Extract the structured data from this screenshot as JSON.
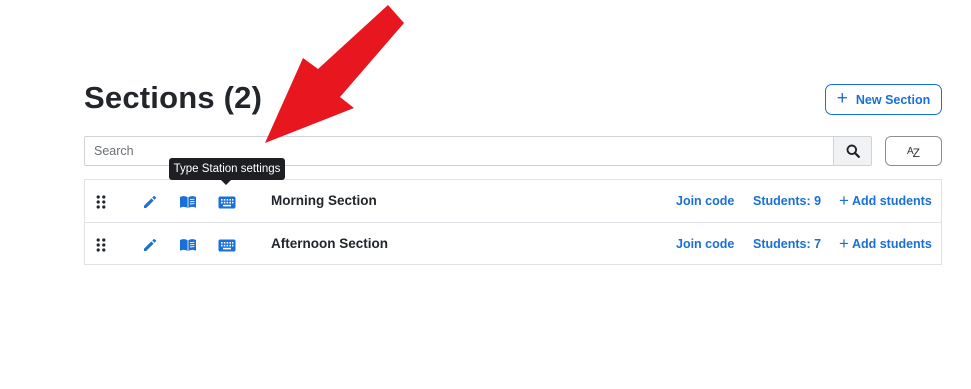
{
  "header": {
    "title": "Sections (2)",
    "new_section_label": "New Section"
  },
  "search": {
    "placeholder": "Search"
  },
  "sort_button": {
    "label_a": "A",
    "label_z": "Z"
  },
  "tooltip": {
    "text": "Type Station settings"
  },
  "sections": [
    {
      "name": "Morning Section",
      "join_code_label": "Join code",
      "students_label": "Students: 9",
      "add_students_label": "Add students"
    },
    {
      "name": "Afternoon Section",
      "join_code_label": "Join code",
      "students_label": "Students: 7",
      "add_students_label": "Add students"
    }
  ],
  "icons": {
    "drag": "drag-handle-icon",
    "edit": "pencil-icon",
    "book": "book-icon",
    "keyboard": "keyboard-icon",
    "search": "search-icon",
    "plus": "plus-icon"
  },
  "colors": {
    "accent": "#1a6fd8",
    "title": "#22262b",
    "tooltip_bg": "#1d1f22",
    "annotation_arrow": "#e8161e"
  }
}
